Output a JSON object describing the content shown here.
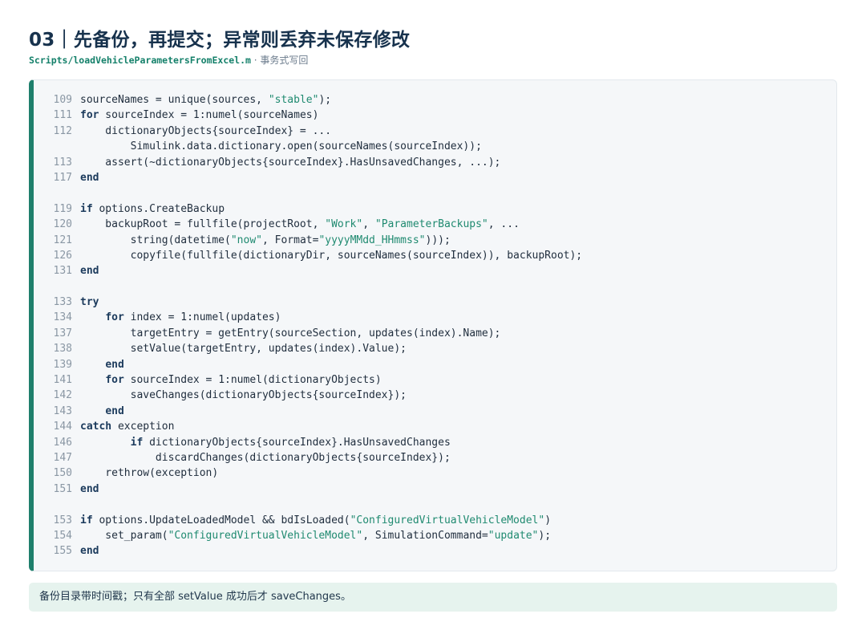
{
  "header": {
    "title": "03｜先备份，再提交；异常则丢弃未保存修改",
    "file_path": "Scripts/loadVehicleParametersFromExcel.m",
    "separator": " · ",
    "description": "事务式写回"
  },
  "code": {
    "lines": [
      {
        "num": "109",
        "tokens": [
          {
            "t": "sourceNames = unique(sources, "
          },
          {
            "t": "\"stable\"",
            "c": "str"
          },
          {
            "t": ");"
          }
        ]
      },
      {
        "num": "111",
        "tokens": [
          {
            "t": "for",
            "c": "kw"
          },
          {
            "t": " sourceIndex = 1:numel(sourceNames)"
          }
        ]
      },
      {
        "num": "112",
        "tokens": [
          {
            "t": "    dictionaryObjects{sourceIndex} = ..."
          }
        ]
      },
      {
        "num": "",
        "tokens": [
          {
            "t": "        Simulink.data.dictionary.open(sourceNames(sourceIndex));"
          }
        ]
      },
      {
        "num": "113",
        "tokens": [
          {
            "t": "    assert(~dictionaryObjects{sourceIndex}.HasUnsavedChanges, ...);"
          }
        ]
      },
      {
        "num": "117",
        "tokens": [
          {
            "t": "end",
            "c": "kw"
          }
        ]
      },
      {
        "num": "",
        "tokens": []
      },
      {
        "num": "119",
        "tokens": [
          {
            "t": "if",
            "c": "kw"
          },
          {
            "t": " options.CreateBackup"
          }
        ]
      },
      {
        "num": "120",
        "tokens": [
          {
            "t": "    backupRoot = fullfile(projectRoot, "
          },
          {
            "t": "\"Work\"",
            "c": "str"
          },
          {
            "t": ", "
          },
          {
            "t": "\"ParameterBackups\"",
            "c": "str"
          },
          {
            "t": ", ..."
          }
        ]
      },
      {
        "num": "121",
        "tokens": [
          {
            "t": "        string(datetime("
          },
          {
            "t": "\"now\"",
            "c": "str"
          },
          {
            "t": ", Format="
          },
          {
            "t": "\"yyyyMMdd_HHmmss\"",
            "c": "str"
          },
          {
            "t": ")));"
          }
        ]
      },
      {
        "num": "126",
        "tokens": [
          {
            "t": "        copyfile(fullfile(dictionaryDir, sourceNames(sourceIndex)), backupRoot);"
          }
        ]
      },
      {
        "num": "131",
        "tokens": [
          {
            "t": "end",
            "c": "kw"
          }
        ]
      },
      {
        "num": "",
        "tokens": []
      },
      {
        "num": "133",
        "tokens": [
          {
            "t": "try",
            "c": "kw"
          }
        ]
      },
      {
        "num": "134",
        "tokens": [
          {
            "t": "    "
          },
          {
            "t": "for",
            "c": "kw"
          },
          {
            "t": " index = 1:numel(updates)"
          }
        ]
      },
      {
        "num": "137",
        "tokens": [
          {
            "t": "        targetEntry = getEntry(sourceSection, updates(index).Name);"
          }
        ]
      },
      {
        "num": "138",
        "tokens": [
          {
            "t": "        setValue(targetEntry, updates(index).Value);"
          }
        ]
      },
      {
        "num": "139",
        "tokens": [
          {
            "t": "    "
          },
          {
            "t": "end",
            "c": "kw"
          }
        ]
      },
      {
        "num": "141",
        "tokens": [
          {
            "t": "    "
          },
          {
            "t": "for",
            "c": "kw"
          },
          {
            "t": " sourceIndex = 1:numel(dictionaryObjects)"
          }
        ]
      },
      {
        "num": "142",
        "tokens": [
          {
            "t": "        saveChanges(dictionaryObjects{sourceIndex});"
          }
        ]
      },
      {
        "num": "143",
        "tokens": [
          {
            "t": "    "
          },
          {
            "t": "end",
            "c": "kw"
          }
        ]
      },
      {
        "num": "144",
        "tokens": [
          {
            "t": "catch",
            "c": "kw"
          },
          {
            "t": " exception"
          }
        ]
      },
      {
        "num": "146",
        "tokens": [
          {
            "t": "        "
          },
          {
            "t": "if",
            "c": "kw"
          },
          {
            "t": " dictionaryObjects{sourceIndex}.HasUnsavedChanges"
          }
        ]
      },
      {
        "num": "147",
        "tokens": [
          {
            "t": "            discardChanges(dictionaryObjects{sourceIndex});"
          }
        ]
      },
      {
        "num": "150",
        "tokens": [
          {
            "t": "    rethrow(exception)"
          }
        ]
      },
      {
        "num": "151",
        "tokens": [
          {
            "t": "end",
            "c": "kw"
          }
        ]
      },
      {
        "num": "",
        "tokens": []
      },
      {
        "num": "153",
        "tokens": [
          {
            "t": "if",
            "c": "kw"
          },
          {
            "t": " options.UpdateLoadedModel && bdIsLoaded("
          },
          {
            "t": "\"ConfiguredVirtualVehicleModel\"",
            "c": "str"
          },
          {
            "t": ")"
          }
        ]
      },
      {
        "num": "154",
        "tokens": [
          {
            "t": "    set_param("
          },
          {
            "t": "\"ConfiguredVirtualVehicleModel\"",
            "c": "str"
          },
          {
            "t": ", SimulationCommand="
          },
          {
            "t": "\"update\"",
            "c": "str"
          },
          {
            "t": ");"
          }
        ]
      },
      {
        "num": "155",
        "tokens": [
          {
            "t": "end",
            "c": "kw"
          }
        ]
      }
    ]
  },
  "note": {
    "text": "备份目录带时间戳；只有全部 setValue 成功后才 saveChanges。"
  },
  "colors": {
    "accent": "#1f7f6c",
    "keyword": "#1b3a5c",
    "string": "#1f8a70",
    "note_bg": "#e6f3ee"
  }
}
